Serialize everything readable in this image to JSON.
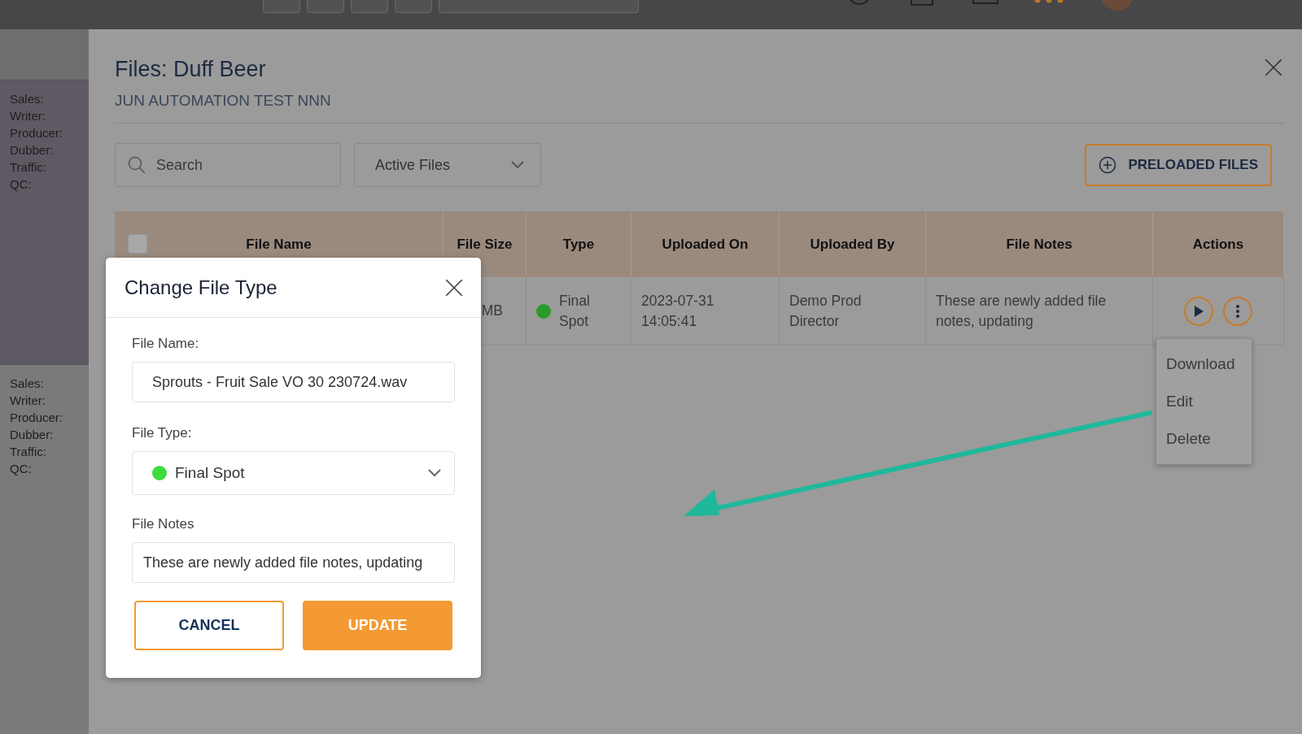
{
  "sidebar": {
    "cards": [
      {
        "labels": [
          "Sales:",
          "Writer:",
          "Producer:",
          "Dubber:",
          "Traffic:",
          "QC:"
        ]
      },
      {
        "labels": [
          "Sales:",
          "Writer:",
          "Producer:",
          "Dubber:",
          "Traffic:",
          "QC:"
        ]
      }
    ]
  },
  "panel": {
    "title": "Files: Duff Beer",
    "subtitle": "JUN AUTOMATION TEST NNN",
    "search": {
      "placeholder": "Search"
    },
    "filter": {
      "value": "Active Files"
    },
    "preload_button": "PRELOADED FILES"
  },
  "table": {
    "select_all": {
      "checked": false
    },
    "columns": [
      "File Name",
      "File Size",
      "Type",
      "Uploaded On",
      "Uploaded By",
      "File Notes",
      "Actions"
    ],
    "rows": [
      {
        "file_size": "MB",
        "type": {
          "label": "Final Spot",
          "color": "#2a9a2a"
        },
        "uploaded_on": "2023-07-31 14:05:41",
        "uploaded_by": "Demo Prod Director",
        "file_notes": "These are newly added file notes, updating"
      }
    ]
  },
  "actions_menu": {
    "items": [
      "Download",
      "Edit",
      "Delete"
    ]
  },
  "modal": {
    "title": "Change File Type",
    "fields": [
      {
        "kind": "text",
        "label": "File Name:",
        "value": "Sprouts - Fruit Sale VO 30 230724.wav"
      },
      {
        "kind": "select",
        "label": "File Type:",
        "value": "Final Spot",
        "color": "#3ddc3d"
      },
      {
        "kind": "text",
        "label": "File Notes",
        "value": "These are newly added file notes, updating"
      }
    ],
    "buttons": [
      {
        "kind": "secondary",
        "label": "CANCEL"
      },
      {
        "kind": "primary",
        "label": "UPDATE"
      }
    ]
  }
}
